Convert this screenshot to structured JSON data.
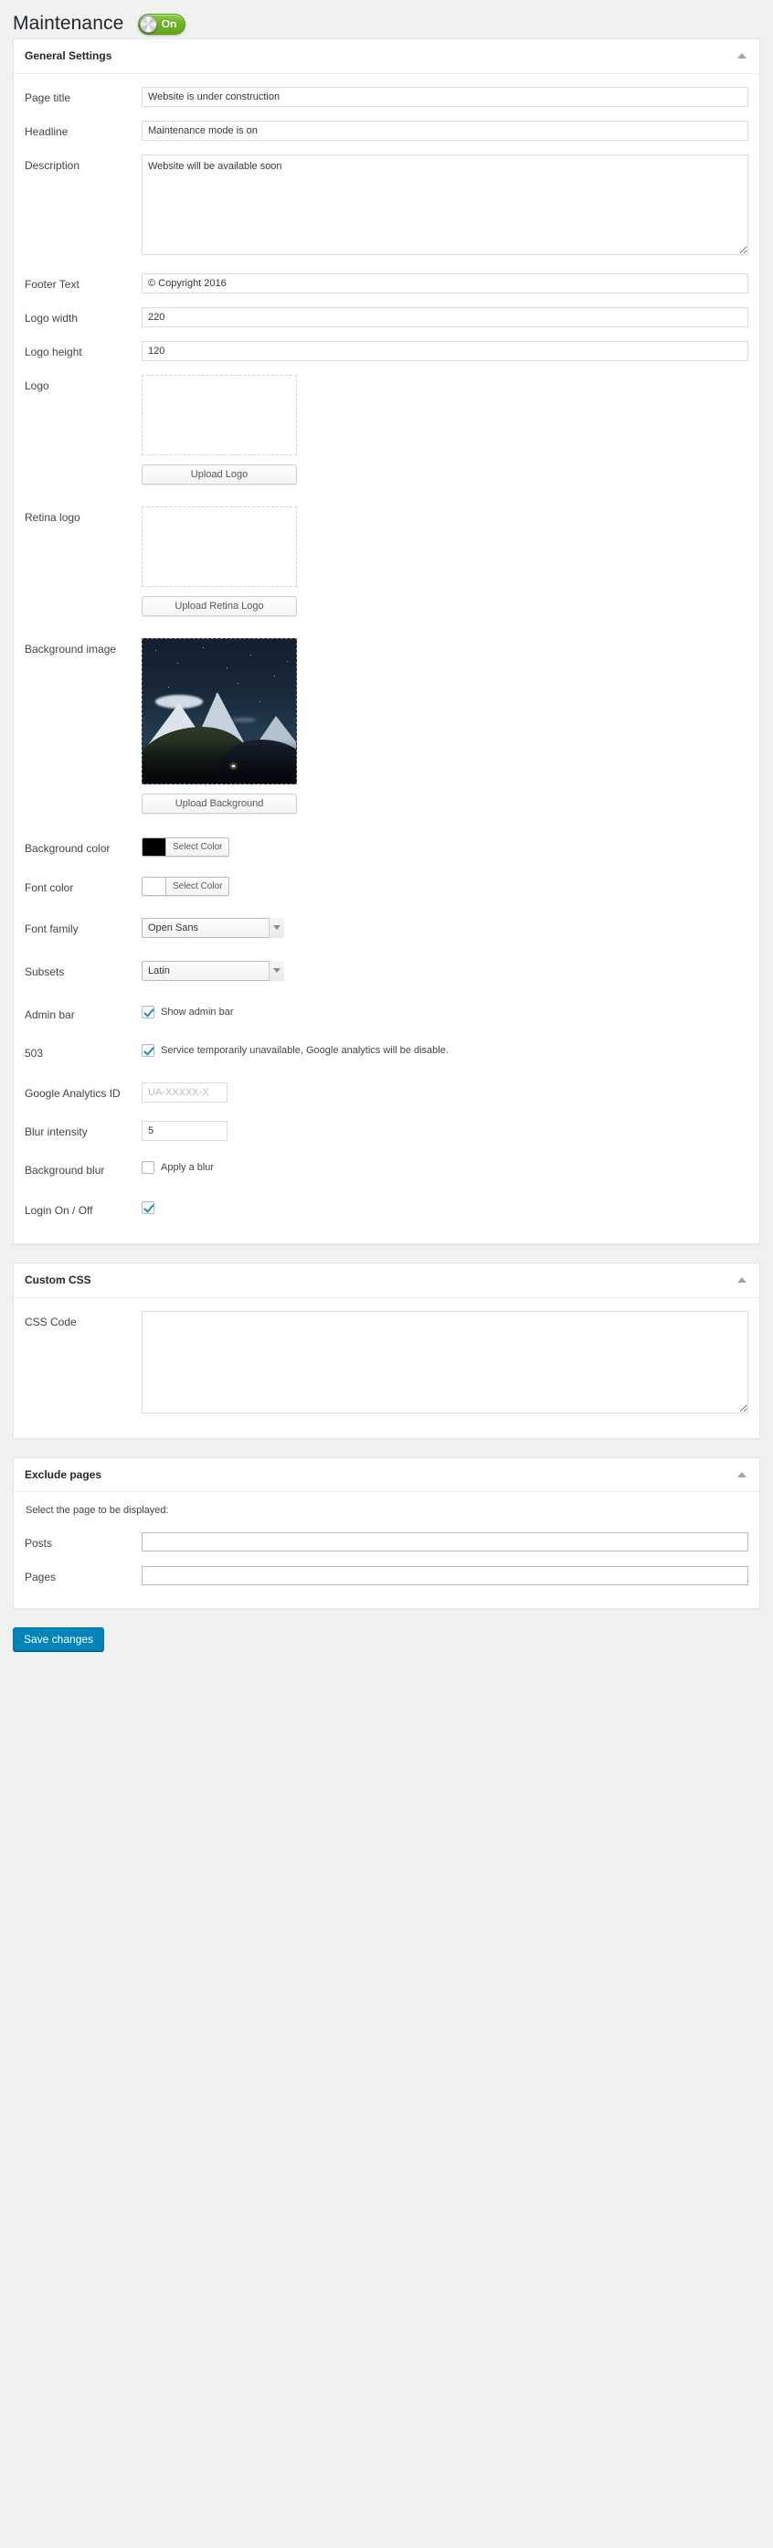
{
  "header": {
    "title": "Maintenance",
    "toggle": {
      "state_label": "On",
      "enabled": true,
      "on_color": "#6cb024"
    }
  },
  "panels": {
    "general": {
      "title": "General Settings",
      "collapse_icon": "chevron-up-icon",
      "fields": {
        "page_title": {
          "label": "Page title",
          "value": "Website is under construction"
        },
        "headline": {
          "label": "Headline",
          "value": "Maintenance mode is on"
        },
        "description": {
          "label": "Description",
          "value": "Website will be available soon"
        },
        "footer_text": {
          "label": "Footer Text",
          "value": "© Copyright 2016"
        },
        "logo_width": {
          "label": "Logo width",
          "value": "220"
        },
        "logo_height": {
          "label": "Logo height",
          "value": "120"
        },
        "logo": {
          "label": "Logo",
          "upload_button": "Upload Logo"
        },
        "retina_logo": {
          "label": "Retina logo",
          "upload_button": "Upload Retina Logo"
        },
        "background_image": {
          "label": "Background image",
          "upload_button": "Upload Background"
        },
        "background_color": {
          "label": "Background color",
          "button": "Select Color",
          "swatch": "#000000"
        },
        "font_color": {
          "label": "Font color",
          "button": "Select Color",
          "swatch": "#ffffff"
        },
        "font_family": {
          "label": "Font family",
          "value": "Open Sans"
        },
        "subsets": {
          "label": "Subsets",
          "value": "Latin"
        },
        "admin_bar": {
          "label": "Admin bar",
          "checkbox_label": "Show admin bar",
          "checked": true
        },
        "error_503": {
          "label": "503",
          "checkbox_label": "Service temporarily unavailable, Google analytics will be disable.",
          "checked": true
        },
        "google_analytics": {
          "label": "Google Analytics ID",
          "value": "",
          "placeholder": "UA-XXXXX-X"
        },
        "blur_intensity": {
          "label": "Blur intensity",
          "value": "5"
        },
        "background_blur": {
          "label": "Background blur",
          "checkbox_label": "Apply a blur",
          "checked": false
        },
        "login_toggle": {
          "label": "Login On / Off",
          "checkbox_label": "",
          "checked": true
        }
      }
    },
    "custom_css": {
      "title": "Custom CSS",
      "collapse_icon": "chevron-up-icon",
      "fields": {
        "css_code": {
          "label": "CSS Code",
          "value": ""
        }
      }
    },
    "exclude_pages": {
      "title": "Exclude pages",
      "collapse_icon": "chevron-up-icon",
      "note": "Select the page to be displayed:",
      "fields": {
        "posts": {
          "label": "Posts",
          "value": ""
        },
        "pages": {
          "label": "Pages",
          "value": ""
        }
      }
    }
  },
  "footer": {
    "save_button": "Save changes",
    "save_button_color": "#0085ba"
  }
}
